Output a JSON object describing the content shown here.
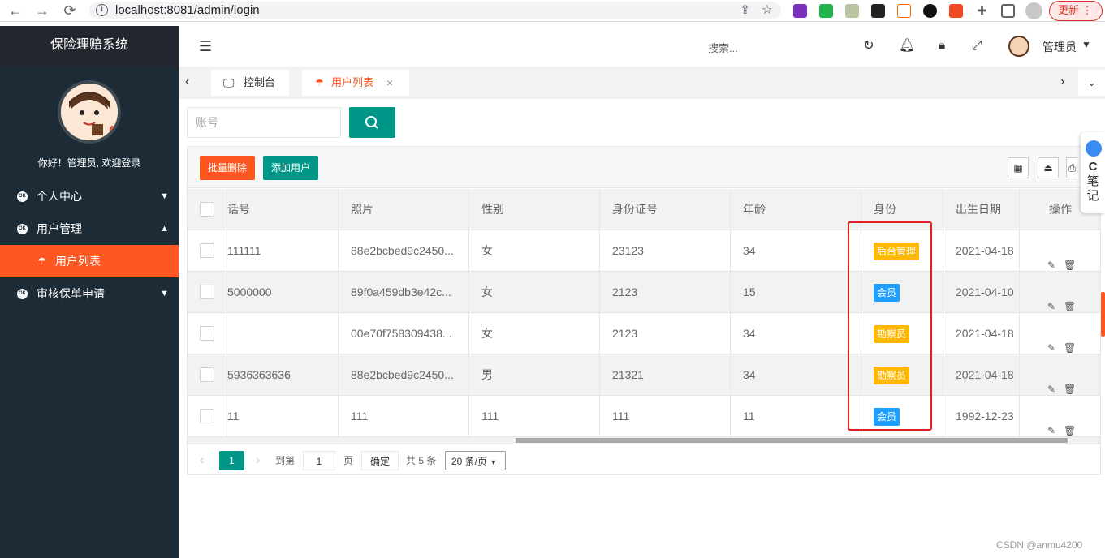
{
  "browser": {
    "url": "localhost:8081/admin/login",
    "update_label": "更新"
  },
  "sidebar": {
    "app_title": "保险理赔系统",
    "welcome": "你好！管理员, 欢迎登录",
    "menu_icon_text": "OK",
    "items": [
      {
        "label": "个人中心",
        "expanded": false
      },
      {
        "label": "用户管理",
        "expanded": true
      },
      {
        "label": "用户列表",
        "active": true
      },
      {
        "label": "审核保单申请",
        "expanded": false
      }
    ]
  },
  "header": {
    "search_placeholder": "搜索...",
    "user_name": "管理员"
  },
  "tabs": [
    {
      "label": "控制台"
    },
    {
      "label": "用户列表",
      "active": true
    }
  ],
  "search": {
    "placeholder": "账号"
  },
  "toolbar": {
    "batch_delete": "批量删除",
    "add_user": "添加用户"
  },
  "table": {
    "headers": [
      "话号",
      "照片",
      "性别",
      "身份证号",
      "年龄",
      "身份",
      "出生日期",
      "操作"
    ],
    "rows": [
      {
        "phone": "111111",
        "photo": "88e2bcbed9c2450...",
        "gender": "女",
        "id_no": "23123",
        "age": "34",
        "role": "后台管理",
        "role_color": "#ffb800",
        "birth": "2021-04-18"
      },
      {
        "phone": "5000000",
        "photo": "89f0a459db3e42c...",
        "gender": "女",
        "id_no": "2123",
        "age": "15",
        "role": "会员",
        "role_color": "#1e9fff",
        "birth": "2021-04-10"
      },
      {
        "phone": "",
        "photo": "00e70f758309438...",
        "gender": "女",
        "id_no": "2123",
        "age": "34",
        "role": "勘察员",
        "role_color": "#ffb800",
        "birth": "2021-04-18"
      },
      {
        "phone": "5936363636",
        "photo": "88e2bcbed9c2450...",
        "gender": "男",
        "id_no": "21321",
        "age": "34",
        "role": "勘察员",
        "role_color": "#ffb800",
        "birth": "2021-04-18"
      },
      {
        "phone": "11",
        "photo": "111",
        "gender": "111",
        "id_no": "111",
        "age": "11",
        "role": "会员",
        "role_color": "#1e9fff",
        "birth": "1992-12-23"
      }
    ]
  },
  "pager": {
    "current_page": "1",
    "goto_label": "到第",
    "goto_value": "1",
    "page_unit": "页",
    "confirm": "确定",
    "total": "共 5 条",
    "page_size": "20 条/页"
  },
  "side_widget": {
    "line1": "C",
    "line2": "笔",
    "line3": "记"
  },
  "watermark": "CSDN @anmu4200",
  "colors": {
    "primary": "#009688",
    "accent": "#ff5722",
    "sidebar_bg": "#1c2b36"
  }
}
